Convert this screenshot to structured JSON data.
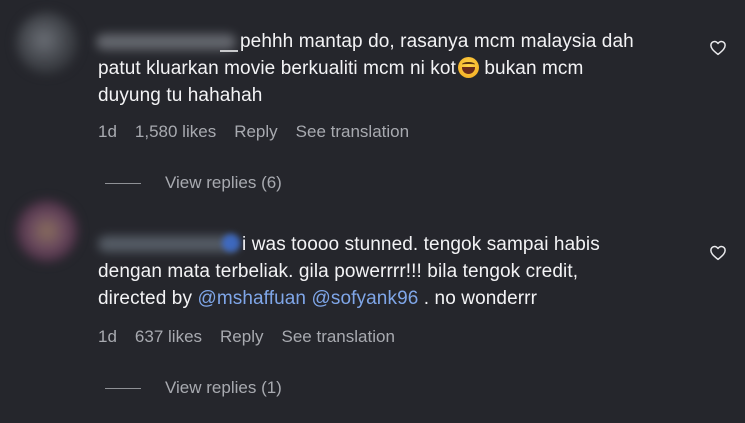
{
  "comments": [
    {
      "username": "",
      "text_lines": [
        "pehhh mantap do, rasanya mcm malaysia dah",
        "patut kluarkan movie berkualiti mcm ni kot",
        "bukan mcm",
        "duyung tu hahahah"
      ],
      "time": "1d",
      "likes": "1,580 likes",
      "reply_label": "Reply",
      "translate_label": "See translation",
      "view_replies": "View replies (6)",
      "like_icon": "heart-outline-icon"
    },
    {
      "username": "",
      "text_lines": [
        "i was toooo stunned. tengok sampai habis",
        "dengan mata terbeliak. gila powerrrr!!! bila tengok credit,",
        "directed by",
        "@mshaffuan",
        "@sofyank96",
        ". no wonderrr"
      ],
      "time": "1d",
      "likes": "637 likes",
      "reply_label": "Reply",
      "translate_label": "See translation",
      "view_replies": "View replies (1)",
      "like_icon": "heart-outline-icon"
    }
  ],
  "colors": {
    "background": "#25262c",
    "text": "#f3f3f5",
    "meta": "#a8aab0",
    "mention": "#7fa6e8"
  }
}
